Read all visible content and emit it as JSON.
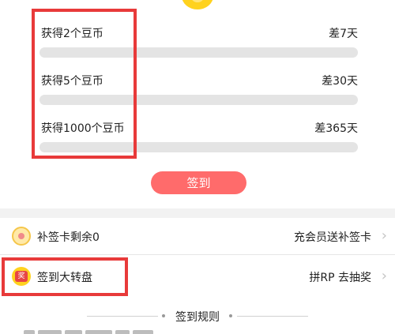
{
  "goals": [
    {
      "label": "获得2个豆币",
      "remaining": "差7天"
    },
    {
      "label": "获得5个豆币",
      "remaining": "差30天"
    },
    {
      "label": "获得1000个豆币",
      "remaining": "差365天"
    }
  ],
  "sign_button": "签到",
  "rows": {
    "makeup_card": {
      "title": "补签卡剩余0",
      "action": "充会员送补签卡",
      "icon": "makeup-card-icon"
    },
    "wheel": {
      "title": "签到大转盘",
      "action": "拼RP  去抽奖",
      "icon": "prize-wheel-icon",
      "icon_text": "奖"
    }
  },
  "rules_title": "签到规则",
  "colors": {
    "accent": "#ff6b6b",
    "highlight_border": "#e83a3a",
    "progress_track": "#e4e4e4",
    "coin": "#ffd21f"
  }
}
